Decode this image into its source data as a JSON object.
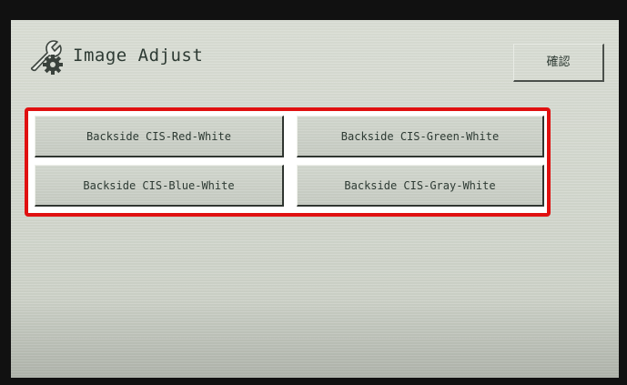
{
  "header": {
    "title": "Image Adjust",
    "title_icon": "wrench-gear-icon",
    "confirm_label": "確認"
  },
  "buttons": [
    {
      "label": "Backside CIS-Red-White"
    },
    {
      "label": "Backside CIS-Green-White"
    },
    {
      "label": "Backside CIS-Blue-White"
    },
    {
      "label": "Backside CIS-Gray-White"
    }
  ],
  "colors": {
    "highlight": "#e01010",
    "screen_background": "#d6dad1",
    "text": "#2d3a33"
  }
}
